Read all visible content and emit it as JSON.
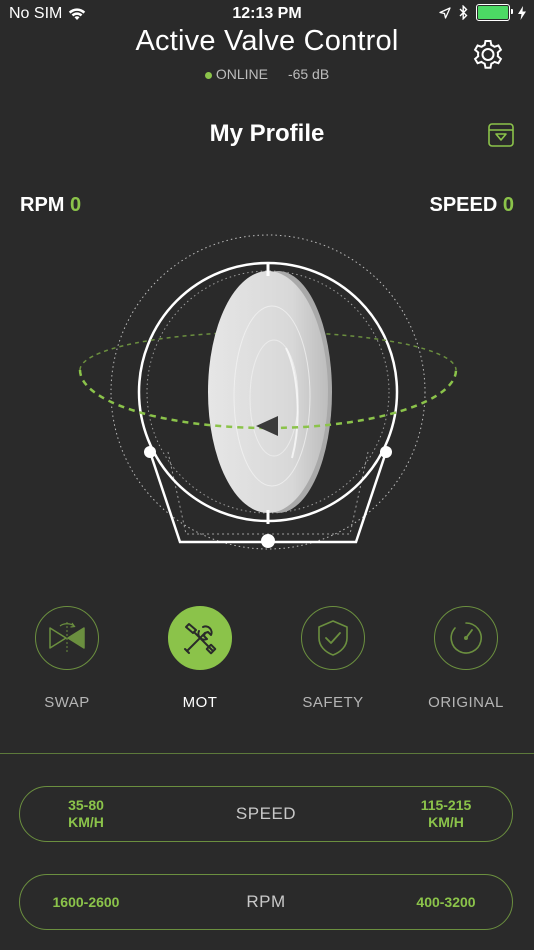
{
  "status_bar": {
    "carrier": "No SIM",
    "time": "12:13 PM"
  },
  "header": {
    "title": "Active Valve Control",
    "connection_status": "ONLINE",
    "signal": "-65 dB"
  },
  "profile": {
    "title": "My Profile"
  },
  "readouts": {
    "rpm_label": "RPM",
    "rpm_value": "0",
    "speed_label": "SPEED",
    "speed_value": "0"
  },
  "modes": [
    {
      "label": "SWAP",
      "icon": "valve-swap-icon",
      "active": false
    },
    {
      "label": "MOT",
      "icon": "tools-icon",
      "active": true
    },
    {
      "label": "SAFETY",
      "icon": "shield-check-icon",
      "active": false
    },
    {
      "label": "ORIGINAL",
      "icon": "gauge-icon",
      "active": false
    }
  ],
  "ranges": {
    "speed": {
      "low_value": "35-80",
      "low_unit": "KM/H",
      "label": "SPEED",
      "high_value": "115-215",
      "high_unit": "KM/H"
    },
    "rpm": {
      "low": "1600-2600",
      "label": "RPM",
      "high": "400-3200"
    }
  },
  "colors": {
    "background": "#2a2a2a",
    "accent": "#8bc34a",
    "battery": "#4cd964"
  }
}
